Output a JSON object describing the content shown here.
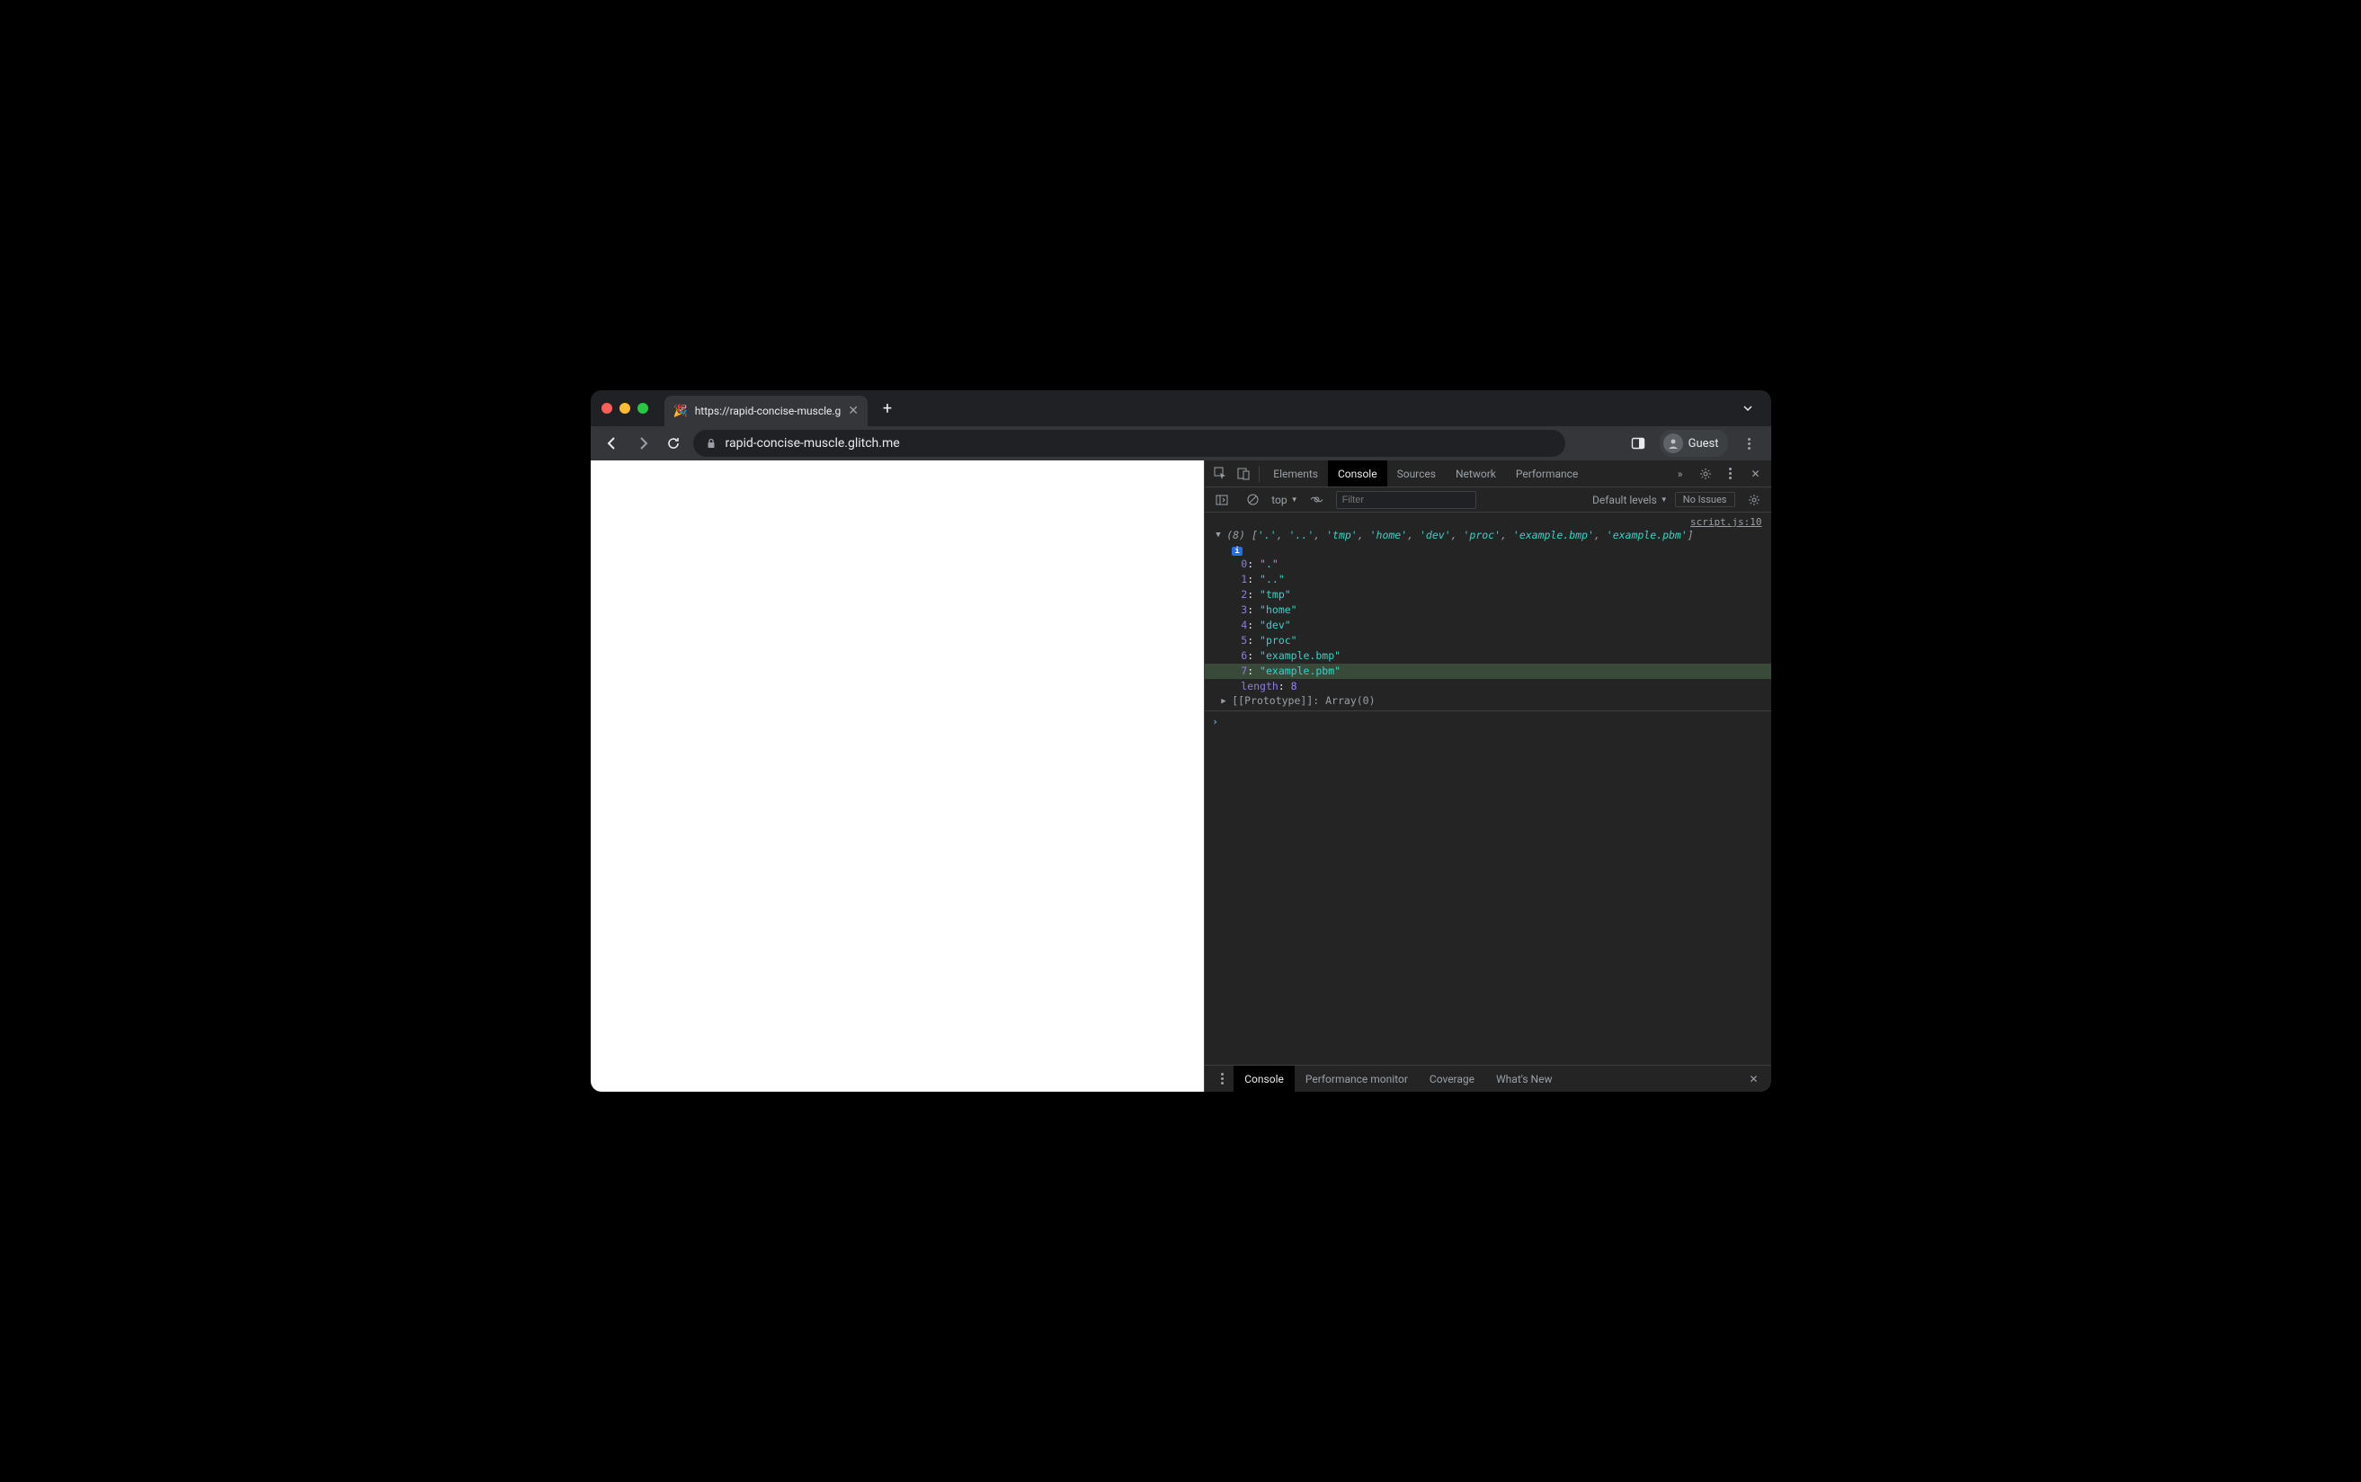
{
  "browser": {
    "tab_title": "https://rapid-concise-muscle.g",
    "tab_favicon": "🎉",
    "url_display": "rapid-concise-muscle.glitch.me",
    "guest_label": "Guest"
  },
  "devtools": {
    "tabs": [
      "Elements",
      "Console",
      "Sources",
      "Network",
      "Performance"
    ],
    "active_tab": "Console",
    "toolbar": {
      "context": "top",
      "filter_placeholder": "Filter",
      "levels_label": "Default levels",
      "issues_label": "No Issues"
    },
    "log": {
      "source": "script.js:10",
      "array_count": "(8)",
      "summary_items": [
        "'.'",
        "'..'",
        "'tmp'",
        "'home'",
        "'dev'",
        "'proc'",
        "'example.bmp'",
        "'example.pbm'"
      ],
      "items": [
        {
          "idx": "0",
          "val": "\".\""
        },
        {
          "idx": "1",
          "val": "\"..\""
        },
        {
          "idx": "2",
          "val": "\"tmp\""
        },
        {
          "idx": "3",
          "val": "\"home\""
        },
        {
          "idx": "4",
          "val": "\"dev\""
        },
        {
          "idx": "5",
          "val": "\"proc\""
        },
        {
          "idx": "6",
          "val": "\"example.bmp\""
        },
        {
          "idx": "7",
          "val": "\"example.pbm\""
        }
      ],
      "highlighted_index": 7,
      "length_key": "length",
      "length_val": "8",
      "proto_label": "[[Prototype]]",
      "proto_val": "Array(0)",
      "info_badge": "i"
    },
    "drawer": {
      "tabs": [
        "Console",
        "Performance monitor",
        "Coverage",
        "What's New"
      ],
      "active_tab": "Console"
    }
  }
}
